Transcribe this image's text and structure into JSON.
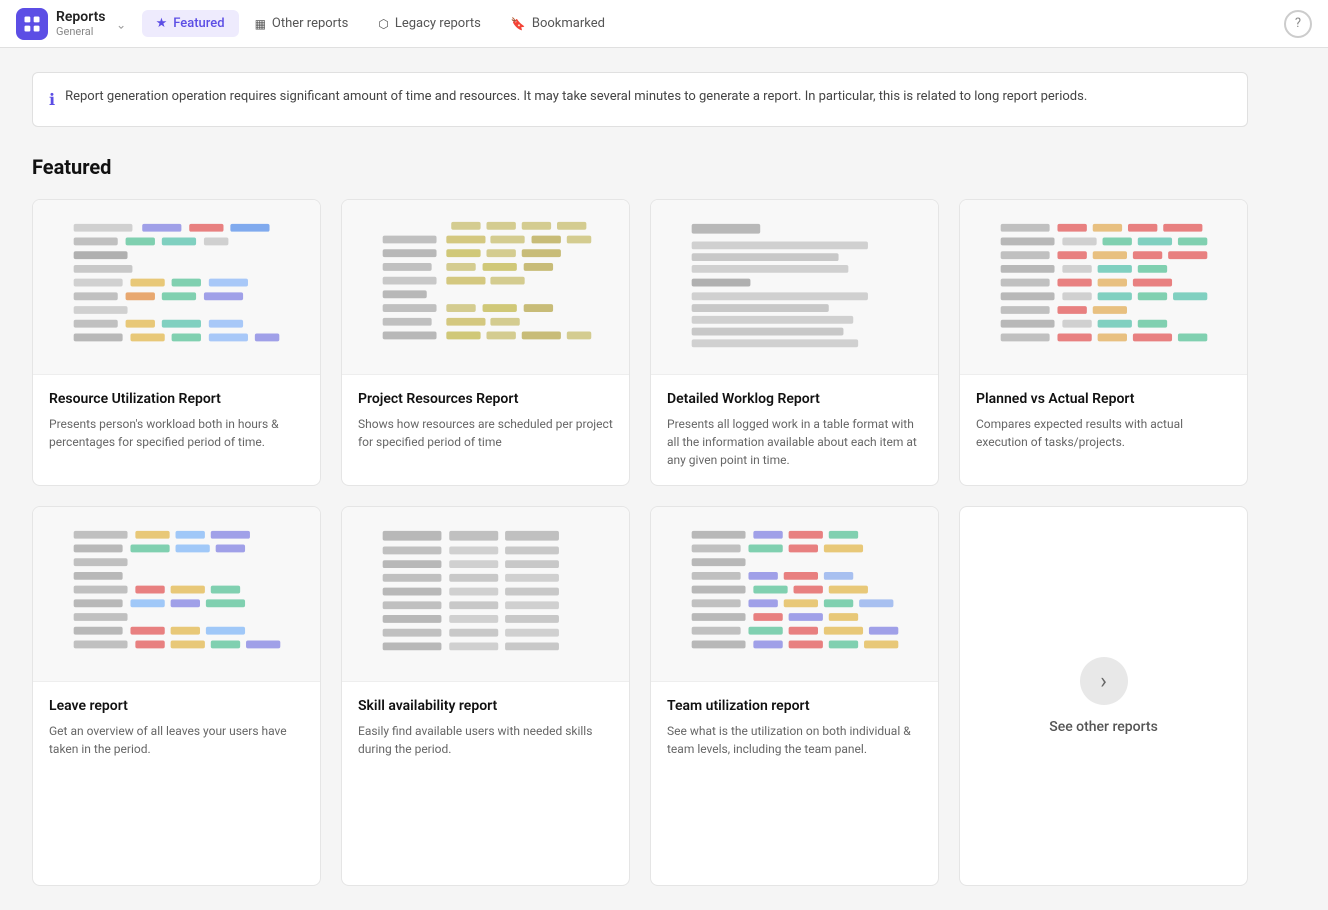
{
  "header": {
    "logo_alt": "App Logo",
    "title": "Reports",
    "subtitle": "General",
    "chevron": "⌃",
    "help_label": "?",
    "tabs": [
      {
        "id": "featured",
        "label": "Featured",
        "icon": "★",
        "active": true
      },
      {
        "id": "other-reports",
        "label": "Other reports",
        "icon": "▦",
        "active": false
      },
      {
        "id": "legacy-reports",
        "label": "Legacy reports",
        "icon": "⬡",
        "active": false
      },
      {
        "id": "bookmarked",
        "label": "Bookmarked",
        "icon": "🔖",
        "active": false
      }
    ]
  },
  "info_banner": {
    "text": "Report generation operation requires significant amount of time and resources. It may take several minutes to generate a report. In particular, this is related to long report periods."
  },
  "featured": {
    "title": "Featured",
    "cards": [
      {
        "id": "resource-utilization",
        "title": "Resource Utilization Report",
        "description": "Presents person's workload both in hours & percentages for specified period of time."
      },
      {
        "id": "project-resources",
        "title": "Project Resources Report",
        "description": "Shows how resources are scheduled per project for specified period of time"
      },
      {
        "id": "detailed-worklog",
        "title": "Detailed Worklog Report",
        "description": "Presents all logged work in a table format with all the information available about each item at any given point in time."
      },
      {
        "id": "planned-vs-actual",
        "title": "Planned vs Actual Report",
        "description": "Compares expected results with actual execution of tasks/projects."
      },
      {
        "id": "leave-report",
        "title": "Leave report",
        "description": "Get an overview of all leaves your users have taken in the period."
      },
      {
        "id": "skill-availability",
        "title": "Skill availability report",
        "description": "Easily find available users with needed skills during the period."
      },
      {
        "id": "team-utilization",
        "title": "Team utilization report",
        "description": "See what is the utilization on both individual & team levels, including the team panel."
      }
    ],
    "see_other_label": "See other reports"
  }
}
